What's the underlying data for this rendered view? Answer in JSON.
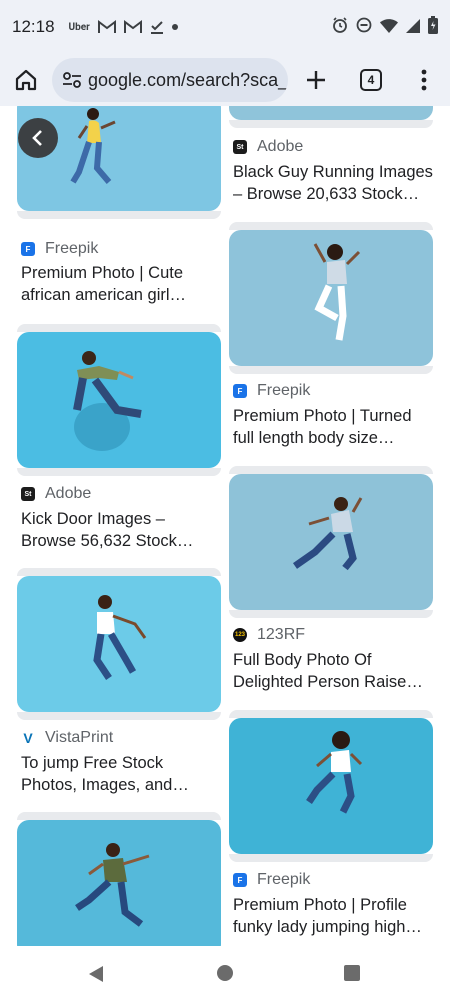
{
  "status": {
    "time": "12:18",
    "uber_label": "Uber",
    "icons": [
      "uber-icon",
      "gmail-icon",
      "gmail-icon",
      "tasks-check-icon",
      "dot-icon",
      "alarm-icon",
      "dnd-icon",
      "wifi-icon",
      "signal-icon",
      "battery-icon"
    ]
  },
  "toolbar": {
    "url": "google.com/search?sca_",
    "tab_count": "4",
    "icons": [
      "home-icon",
      "site-settings-icon",
      "new-tab-icon",
      "tabs-icon",
      "menu-icon"
    ]
  },
  "results": [
    {
      "source": "",
      "source_icon": "",
      "title": "",
      "color_hint": "#7fc3dd"
    },
    {
      "source": "Freepik",
      "source_icon": "F",
      "source_color": "#1a73e8",
      "title_line1": "Premium Photo | Cute",
      "title_line2": "african american girl…"
    },
    {
      "source": "Adobe",
      "source_icon": "St",
      "source_color": "#1c1c1c",
      "title_line1": "Kick Door Images –",
      "title_line2": "Browse 56,632 Stock…"
    },
    {
      "source": "VistaPrint",
      "source_icon": "V",
      "source_color": "#0a74b7",
      "title_line1": "To jump Free Stock",
      "title_line2": "Photos, Images, and…"
    },
    {
      "source": "Adobe",
      "source_icon": "St",
      "source_color": "#1c1c1c",
      "title_line1": "Black Guy Running Images",
      "title_line2": "– Browse 20,633 Stock…"
    },
    {
      "source": "Freepik",
      "source_icon": "F",
      "source_color": "#1a73e8",
      "title_line1": "Premium Photo | Turned",
      "title_line2": "full length body size…"
    },
    {
      "source": "123RF",
      "source_icon": "123",
      "source_color": "#111111",
      "title_line1": "Full Body Photo Of",
      "title_line2": "Delighted Person Raise…"
    },
    {
      "source": "Freepik",
      "source_icon": "F",
      "source_color": "#1a73e8",
      "title_line1": "Premium Photo | Profile",
      "title_line2": "funky lady jumping high…"
    }
  ],
  "colors": {
    "chrome_bg": "#eef1f7",
    "omnibox_bg": "#dde3ee",
    "thumb_blue_1": "#6ec3e6",
    "thumb_blue_2": "#8fc5db",
    "text": "#202124",
    "secondary": "#5f6368"
  },
  "navbar": {
    "icons": [
      "nav-back-icon",
      "nav-home-icon",
      "nav-recents-icon"
    ]
  }
}
